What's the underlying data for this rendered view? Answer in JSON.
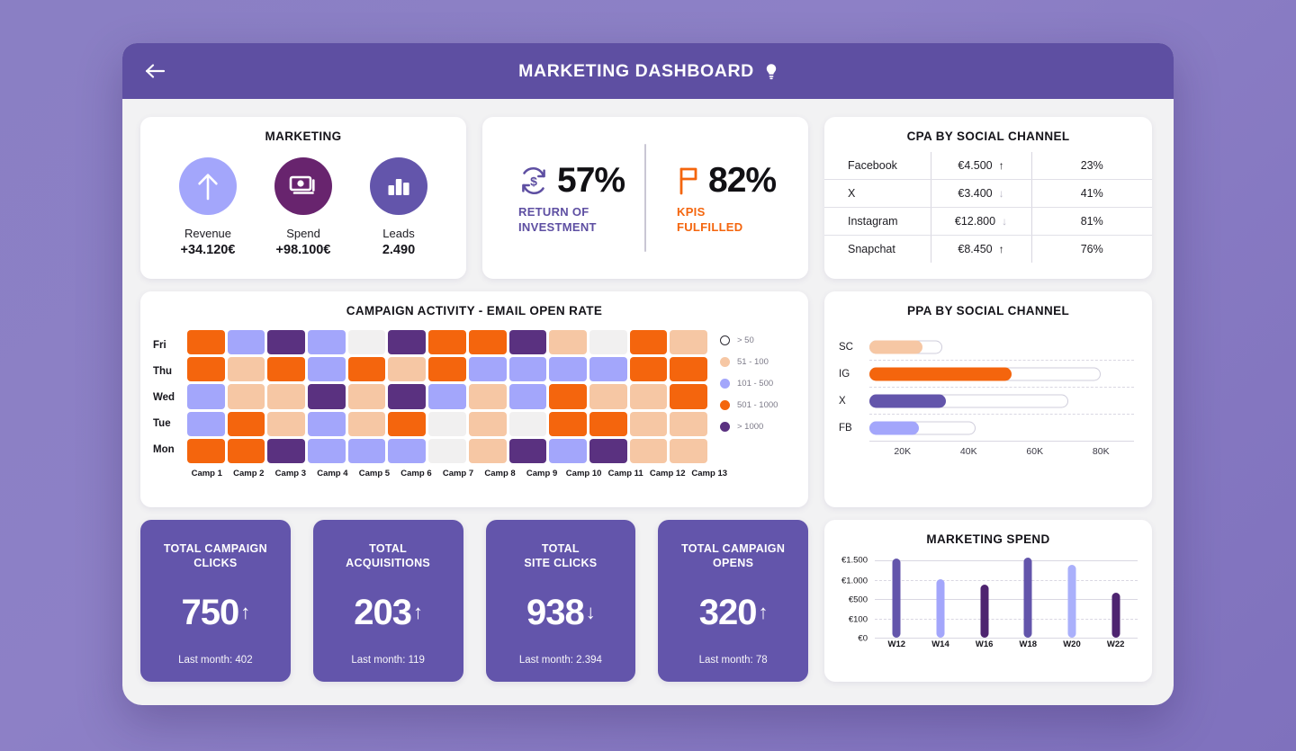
{
  "header": {
    "title": "MARKETING DASHBOARD",
    "back_icon": "arrow-left-icon",
    "bulb_icon": "lightbulb-icon",
    "bg_color": "#5e4fa2"
  },
  "marketing_card": {
    "title": "MARKETING",
    "items": [
      {
        "label": "Revenue",
        "value": "+34.120€",
        "icon": "arrow-up-icon",
        "circle_color": "#a3a6fb"
      },
      {
        "label": "Spend",
        "value": "+98.100€",
        "icon": "money-icon",
        "circle_color": "#68246e"
      },
      {
        "label": "Leads",
        "value": "2.490",
        "icon": "bar-chart-icon",
        "circle_color": "#6355ab"
      }
    ]
  },
  "roi_card": {
    "left": {
      "icon": "return-on-investment-icon",
      "value": "57%",
      "caption_line1": "RETURN OF",
      "caption_line2": "INVESTMENT",
      "color": "#5e4fa2"
    },
    "right": {
      "icon": "flag-icon",
      "value": "82%",
      "caption_line1": "KPIs",
      "caption_line2": "FULFILLED",
      "color": "#f4650d"
    }
  },
  "cpa_card": {
    "title": "CPA BY SOCIAL CHANNEL",
    "rows": [
      {
        "channel": "Facebook",
        "cost": "€4.500",
        "trend": "up",
        "trend_glyph": "↑",
        "pct": "23%"
      },
      {
        "channel": "X",
        "cost": "€3.400",
        "trend": "down",
        "trend_glyph": "↓",
        "pct": "41%"
      },
      {
        "channel": "Instagram",
        "cost": "€12.800",
        "trend": "down",
        "trend_glyph": "↓",
        "pct": "81%"
      },
      {
        "channel": "Snapchat",
        "cost": "€8.450",
        "trend": "up",
        "trend_glyph": "↑",
        "pct": "76%"
      }
    ]
  },
  "heatmap_card": {
    "title": "CAMPAIGN ACTIVITY - EMAIL OPEN RATE",
    "legend": [
      {
        "label": "> 50",
        "color": "#ffffff",
        "ring": true
      },
      {
        "label": "51 - 100",
        "color": "#f6c7a4",
        "ring": false
      },
      {
        "label": "101 - 500",
        "color": "#a3a6fb",
        "ring": false
      },
      {
        "label": "501 - 1000",
        "color": "#f4650d",
        "ring": false
      },
      {
        "label": "> 1000",
        "color": "#5a3180",
        "ring": false
      }
    ]
  },
  "ppa_card": {
    "title": "PPA BY SOCIAL CHANNEL",
    "axis_ticks": [
      "20K",
      "40K",
      "60K",
      "80K"
    ]
  },
  "stats": [
    {
      "title_line1": "TOTAL CAMPAIGN",
      "title_line2": "CLICKS",
      "value": "750",
      "trend_glyph": "↑",
      "sub": "Last month: 402"
    },
    {
      "title_line1": "TOTAL",
      "title_line2": "ACQUISITIONS",
      "value": "203",
      "trend_glyph": "↑",
      "sub": "Last month: 119"
    },
    {
      "title_line1": "TOTAL",
      "title_line2": "SITE CLICKS",
      "value": "938",
      "trend_glyph": "↓",
      "sub": "Last month: 2.394"
    },
    {
      "title_line1": "TOTAL CAMPAIGN",
      "title_line2": "OPENS",
      "value": "320",
      "trend_glyph": "↑",
      "sub": "Last month: 78"
    }
  ],
  "spend_card": {
    "title": "MARKETING SPEND"
  },
  "chart_data": [
    {
      "type": "heatmap",
      "title": "CAMPAIGN ACTIVITY - EMAIL OPEN RATE",
      "xlabel": "",
      "ylabel": "",
      "x_categories": [
        "Camp 1",
        "Camp 2",
        "Camp 3",
        "Camp 4",
        "Camp 5",
        "Camp 6",
        "Camp 7",
        "Camp 8",
        "Camp 9",
        "Camp 10",
        "Camp 11",
        "Camp 12",
        "Camp 13"
      ],
      "y_categories": [
        "Fri",
        "Thu",
        "Wed",
        "Tue",
        "Mon"
      ],
      "bins": [
        {
          "label": "> 50",
          "color": "#ffffff"
        },
        {
          "label": "51 - 100",
          "color": "#f6c7a4"
        },
        {
          "label": "101 - 500",
          "color": "#a3a6fb"
        },
        {
          "label": "501 - 1000",
          "color": "#f4650d"
        },
        {
          "label": "> 1000",
          "color": "#5a3180"
        }
      ],
      "legend_position": "right",
      "rows": [
        {
          "day": "Fri",
          "bins": [
            "501 - 1000",
            "101 - 500",
            "> 1000",
            "101 - 500",
            "> 50",
            "> 1000",
            "501 - 1000",
            "501 - 1000",
            "> 1000",
            "51 - 100",
            "> 50",
            "501 - 1000",
            "51 - 100"
          ]
        },
        {
          "day": "Thu",
          "bins": [
            "501 - 1000",
            "51 - 100",
            "501 - 1000",
            "101 - 500",
            "501 - 1000",
            "51 - 100",
            "501 - 1000",
            "101 - 500",
            "101 - 500",
            "101 - 500",
            "101 - 500",
            "501 - 1000",
            "501 - 1000"
          ]
        },
        {
          "day": "Wed",
          "bins": [
            "101 - 500",
            "51 - 100",
            "51 - 100",
            "> 1000",
            "51 - 100",
            "> 1000",
            "101 - 500",
            "51 - 100",
            "101 - 500",
            "501 - 1000",
            "51 - 100",
            "51 - 100",
            "501 - 1000"
          ]
        },
        {
          "day": "Tue",
          "bins": [
            "101 - 500",
            "501 - 1000",
            "51 - 100",
            "101 - 500",
            "51 - 100",
            "501 - 1000",
            "> 50",
            "51 - 100",
            "> 50",
            "501 - 1000",
            "501 - 1000",
            "51 - 100",
            "51 - 100"
          ]
        },
        {
          "day": "Mon",
          "bins": [
            "501 - 1000",
            "501 - 1000",
            "> 1000",
            "101 - 500",
            "101 - 500",
            "101 - 500",
            "> 50",
            "51 - 100",
            "> 1000",
            "101 - 500",
            "> 1000",
            "51 - 100",
            "51 - 100"
          ]
        }
      ]
    },
    {
      "type": "bar",
      "orientation": "horizontal",
      "title": "PPA BY SOCIAL CHANNEL",
      "categories": [
        "SC",
        "IG",
        "X",
        "FB"
      ],
      "values": [
        26000,
        53000,
        33000,
        25000
      ],
      "track_values": [
        32000,
        80000,
        70000,
        42000
      ],
      "bar_colors": [
        "#f6c7a4",
        "#f4650d",
        "#6355ab",
        "#a3a6fb"
      ],
      "xlabel": "",
      "ylabel": "",
      "xlim": [
        10000,
        90000
      ],
      "xticks": [
        20000,
        40000,
        60000,
        80000
      ],
      "xtick_labels": [
        "20K",
        "40K",
        "60K",
        "80K"
      ],
      "grid": true,
      "legend_position": "none"
    },
    {
      "type": "bar",
      "orientation": "vertical",
      "title": "MARKETING SPEND",
      "categories": [
        "W12",
        "W14",
        "W16",
        "W18",
        "W20",
        "W22"
      ],
      "values": [
        1550,
        1010,
        870,
        1620,
        1390,
        670
      ],
      "bar_colors": [
        "#6355ab",
        "#a3a6fb",
        "#4e2470",
        "#6355ab",
        "#aab0fb",
        "#4e2470"
      ],
      "xlabel": "",
      "ylabel": "",
      "yticks": [
        0,
        100,
        500,
        1000,
        1500
      ],
      "ytick_labels": [
        "€0",
        "€100",
        "€500",
        "€1.000",
        "€1.500"
      ],
      "grid": true,
      "legend_position": "none"
    }
  ]
}
